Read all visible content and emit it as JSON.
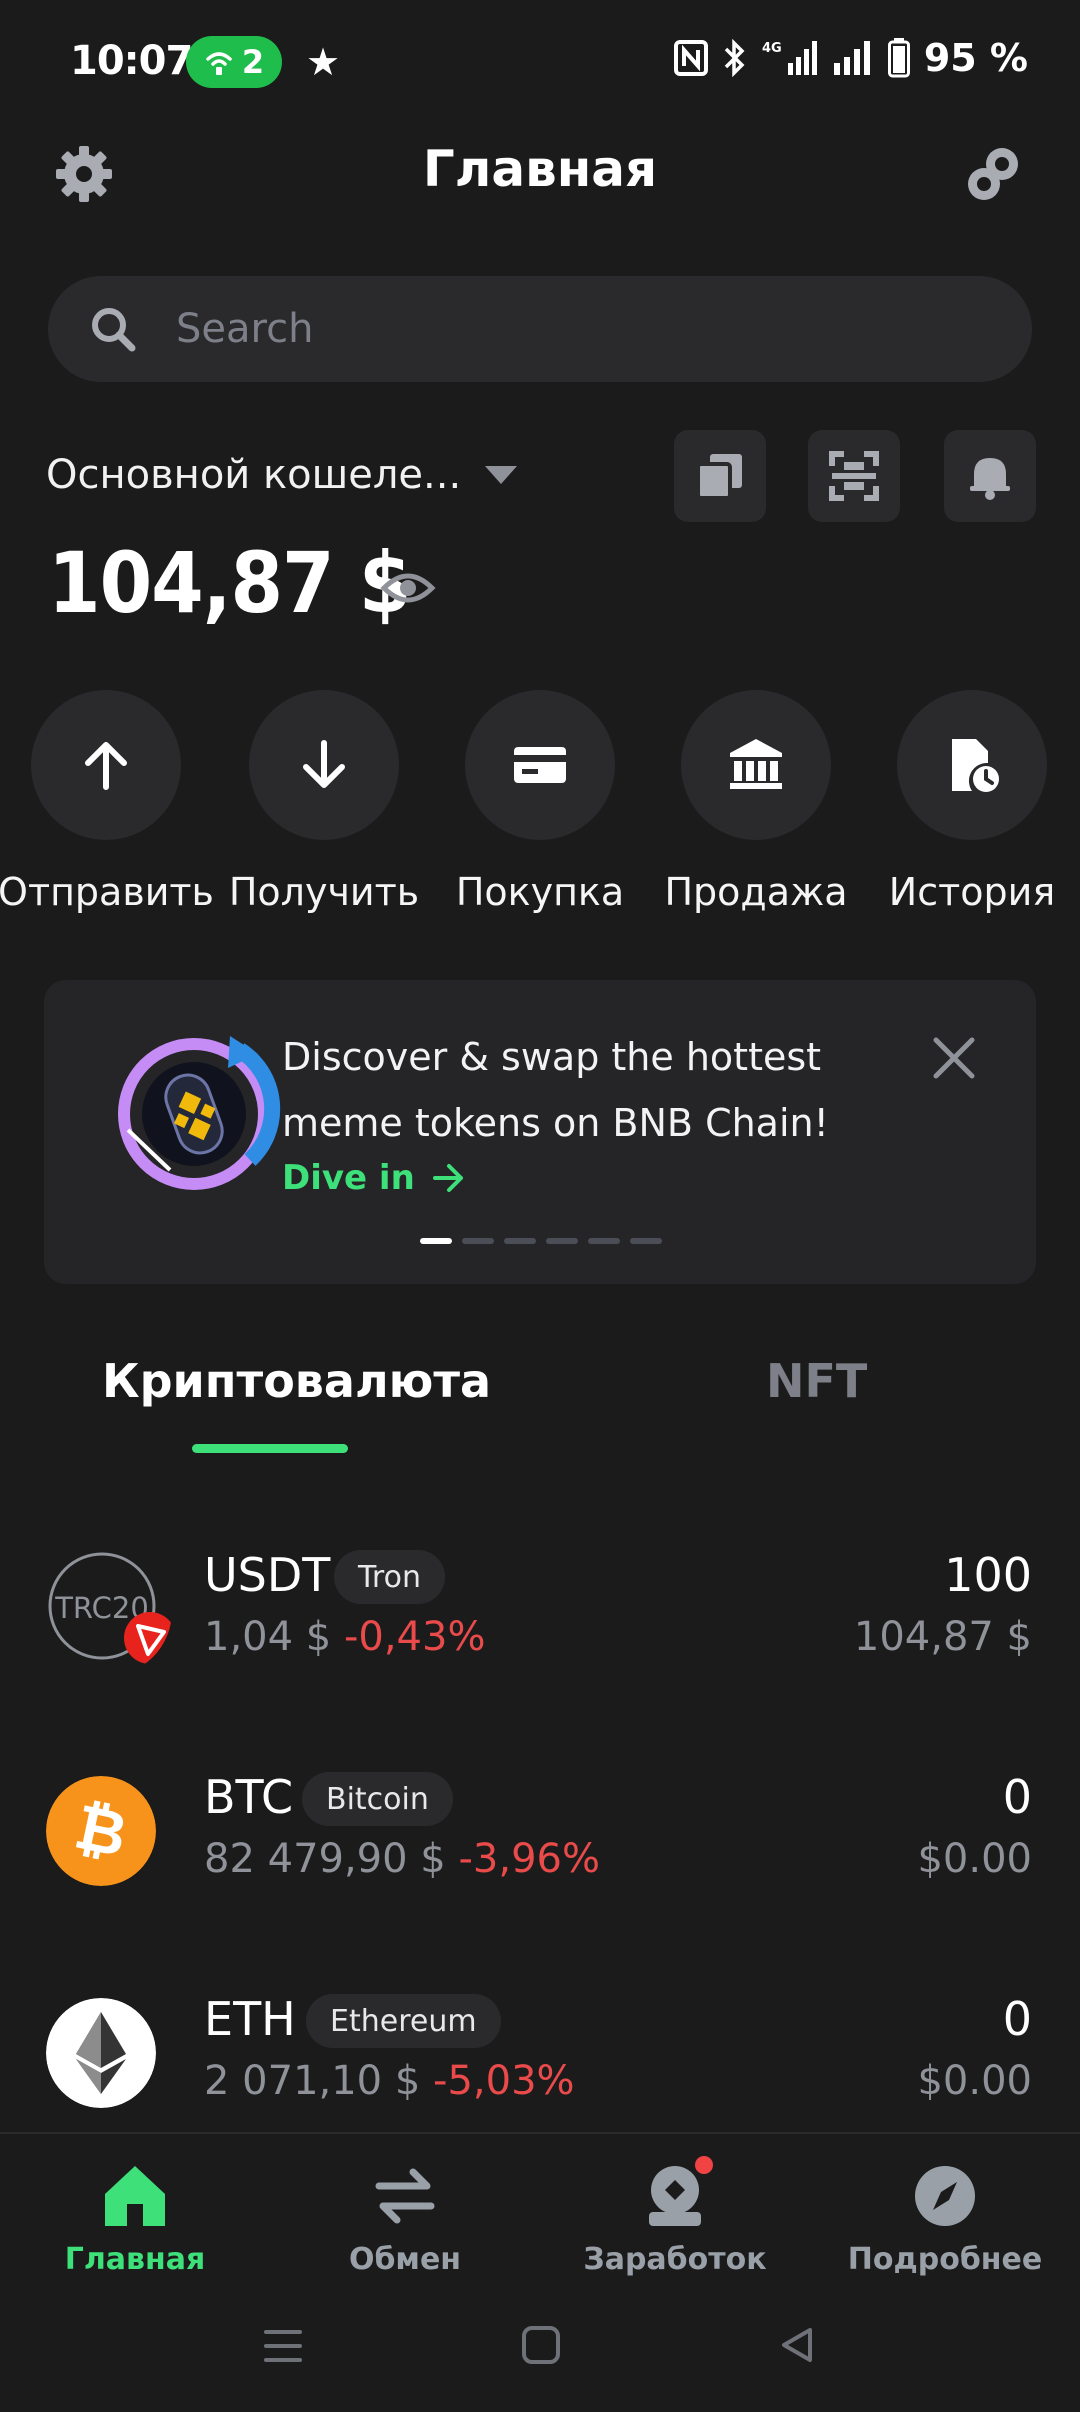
{
  "status_bar": {
    "time": "10:07",
    "hotspot_count": "2",
    "network": "4G",
    "battery": "95 %"
  },
  "header": {
    "title": "Главная",
    "settings_icon": "gear-icon",
    "connect_icon": "wallet-connect-icon"
  },
  "search": {
    "placeholder": "Search"
  },
  "wallet": {
    "name": "Основной кошеле...",
    "balance": "104,87 $"
  },
  "actions": [
    {
      "label": "Отправить",
      "icon": "arrow-up-icon"
    },
    {
      "label": "Получить",
      "icon": "arrow-down-icon"
    },
    {
      "label": "Покупка",
      "icon": "card-icon"
    },
    {
      "label": "Продажа",
      "icon": "bank-icon"
    },
    {
      "label": "История",
      "icon": "history-icon"
    }
  ],
  "banner": {
    "text": "Discover & swap the hottest meme tokens on BNB Chain!",
    "link": "Dive in",
    "slides": 6,
    "active_slide": 1
  },
  "tabs": {
    "crypto": "Криптовалюта",
    "nft": "NFT",
    "active": "crypto"
  },
  "tokens": [
    {
      "symbol": "USDT",
      "chain": "Tron",
      "price": "1,04 $",
      "change": "-0,43%",
      "amount": "100",
      "value": "104,87 $",
      "logo_text": "TRC20"
    },
    {
      "symbol": "BTC",
      "chain": "Bitcoin",
      "price": "82 479,90 $",
      "change": "-3,96%",
      "amount": "0",
      "value": "$0.00"
    },
    {
      "symbol": "ETH",
      "chain": "Ethereum",
      "price": "2 071,10 $",
      "change": "-5,03%",
      "amount": "0",
      "value": "$0.00"
    }
  ],
  "bottom_nav": [
    {
      "label": "Главная",
      "active": true
    },
    {
      "label": "Обмен",
      "active": false
    },
    {
      "label": "Заработок",
      "active": false
    },
    {
      "label": "Подробнее",
      "active": false
    }
  ],
  "colors": {
    "background": "#1b1b1c",
    "surface": "#2a2a2d",
    "accent": "#3ee07a",
    "negative": "#e94a4a",
    "muted": "#8f9299"
  }
}
